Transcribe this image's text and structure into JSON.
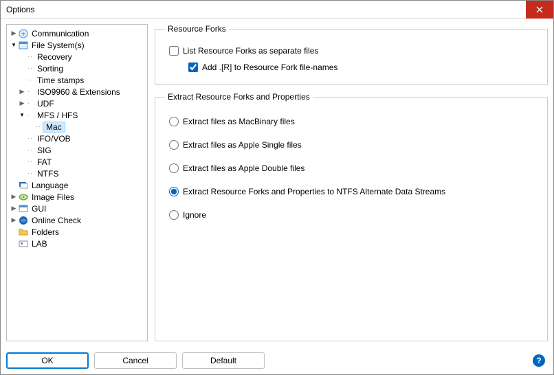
{
  "window": {
    "title": "Options"
  },
  "tree": {
    "communication": "Communication",
    "file_system": "File System(s)",
    "recovery": "Recovery",
    "sorting": "Sorting",
    "time_stamps": "Time stamps",
    "iso9960": "ISO9960 & Extensions",
    "udf": "UDF",
    "mfs_hfs": "MFS / HFS",
    "mac": "Mac",
    "ifo_vob": "IFO/VOB",
    "sig": "SIG",
    "fat": "FAT",
    "ntfs": "NTFS",
    "language": "Language",
    "image_files": "Image Files",
    "gui": "GUI",
    "online_check": "Online Check",
    "folders": "Folders",
    "lab": "LAB"
  },
  "group1": {
    "legend": "Resource Forks",
    "list_label": "List Resource Forks as separate files",
    "list_checked": false,
    "addr_label": "Add .[R] to Resource Fork file-names",
    "addr_checked": true
  },
  "group2": {
    "legend": "Extract Resource Forks and Properties",
    "options": [
      "Extract files as MacBinary files",
      "Extract files as Apple Single files",
      "Extract files as Apple Double files",
      "Extract Resource Forks and Properties to NTFS Alternate Data Streams",
      "Ignore"
    ],
    "selected_index": 3
  },
  "buttons": {
    "ok": "OK",
    "cancel": "Cancel",
    "default": "Default"
  }
}
